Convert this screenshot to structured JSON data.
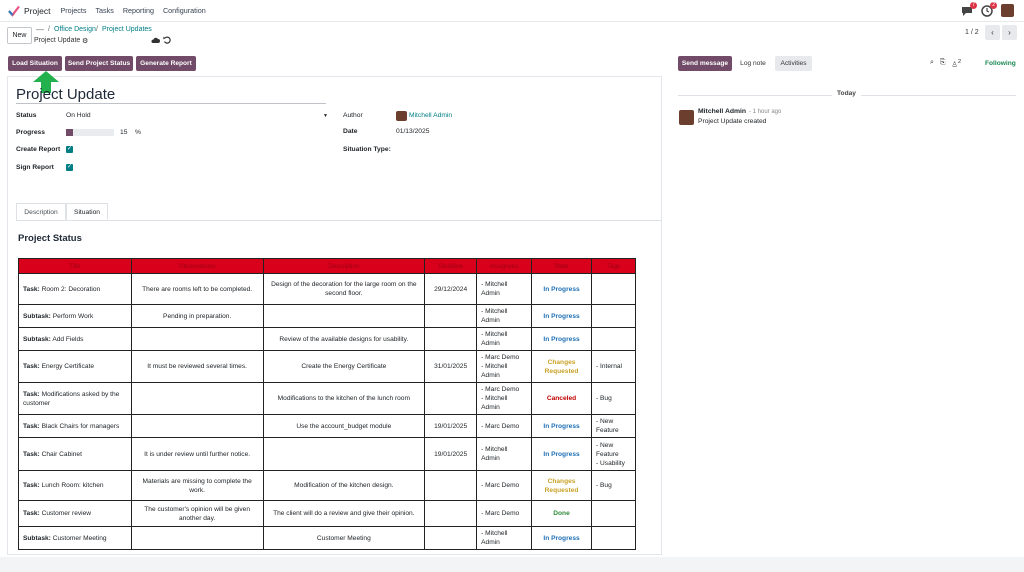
{
  "nav": {
    "app_name": "Project",
    "menu": [
      "Projects",
      "Tasks",
      "Reporting",
      "Configuration"
    ],
    "badges": {
      "chat": "7",
      "activity": "2"
    }
  },
  "control": {
    "new_label": "New",
    "breadcrumb": {
      "dash": "—",
      "sep": "/",
      "crumb1": "Office Design",
      "crumb2": "Project Updates",
      "current": "Project Update"
    },
    "pager": "1 / 2"
  },
  "actions": {
    "load": "Load Situation",
    "send_status": "Send Project Status",
    "generate": "Generate Report"
  },
  "form": {
    "title": "Project Update",
    "status_label": "Status",
    "status_value": "On Hold",
    "progress_label": "Progress",
    "progress_value": "15",
    "progress_unit": "%",
    "progress_fraction": 0.15,
    "create_report_label": "Create Report",
    "sign_report_label": "Sign Report",
    "author_label": "Author",
    "author_value": "Mitchell Admin",
    "date_label": "Date",
    "date_value": "01/13/2025",
    "situation_type_label": "Situation Type:"
  },
  "tabs": [
    "Description",
    "Situation"
  ],
  "section_title": "Project Status",
  "table": {
    "headers": [
      "Title",
      "Observations",
      "Description",
      "Deadline",
      "Assignees",
      "State",
      "Tags"
    ],
    "rows": [
      {
        "kind": "Task:",
        "title": " Room 2: Decoration",
        "obs": "There are rooms left to be completed.",
        "desc": "Design of the decoration for the large room on the second floor.",
        "deadline": "29/12/2024",
        "assignees": [
          "- Mitchell Admin"
        ],
        "state": "In Progress",
        "state_color": "#1f6fb5",
        "tags": []
      },
      {
        "kind": "Subtask:",
        "title": " Perform Work",
        "obs": "Pending in preparation.",
        "desc": "",
        "deadline": "",
        "assignees": [
          "- Mitchell Admin"
        ],
        "state": "In Progress",
        "state_color": "#1f6fb5",
        "tags": []
      },
      {
        "kind": "Subtask:",
        "title": " Add Fields",
        "obs": "",
        "desc": "Review of the available designs for usability.",
        "deadline": "",
        "assignees": [
          "- Mitchell Admin"
        ],
        "state": "In Progress",
        "state_color": "#1f6fb5",
        "tags": []
      },
      {
        "kind": "Task:",
        "title": " Energy Certificate",
        "obs": "It must be reviewed several times.",
        "desc": "Create the Energy Certificate",
        "deadline": "31/01/2025",
        "assignees": [
          "- Marc Demo",
          "- Mitchell Admin"
        ],
        "state": "Changes Requested",
        "state_color": "#c9a227",
        "tags": [
          "- Internal"
        ]
      },
      {
        "kind": "Task:",
        "title": " Modifications asked by the customer",
        "obs": "",
        "desc": "Modifications to the kitchen of the lunch room",
        "deadline": "",
        "assignees": [
          "- Marc Demo",
          "- Mitchell Admin"
        ],
        "state": "Canceled",
        "state_color": "#c00000",
        "tags": [
          "- Bug"
        ]
      },
      {
        "kind": "Task:",
        "title": " Black Chairs for managers",
        "obs": "",
        "desc": "Use the account_budget module",
        "deadline": "19/01/2025",
        "assignees": [
          "- Marc Demo"
        ],
        "state": "In Progress",
        "state_color": "#1f6fb5",
        "tags": [
          "- New Feature"
        ]
      },
      {
        "kind": "Task:",
        "title": " Chair Cabinet",
        "obs": "It is under review until further notice.",
        "desc": "",
        "deadline": "19/01/2025",
        "assignees": [
          "- Mitchell Admin"
        ],
        "state": "In Progress",
        "state_color": "#1f6fb5",
        "tags": [
          "- New Feature",
          "- Usability"
        ]
      },
      {
        "kind": "Task:",
        "title": " Lunch Room: kitchen",
        "obs": "Materials are missing to complete the work.",
        "desc": "Modification of the kitchen design.",
        "deadline": "",
        "assignees": [
          "- Marc Demo"
        ],
        "state": "Changes Requested",
        "state_color": "#c9a227",
        "tags": [
          "- Bug"
        ]
      },
      {
        "kind": "Task:",
        "title": " Customer review",
        "obs": "The customer's opinion will be given another day.",
        "desc": "The client will do a review and give their opinion.",
        "deadline": "",
        "assignees": [
          "- Marc Demo"
        ],
        "state": "Done",
        "state_color": "#2e8b3a",
        "tags": []
      },
      {
        "kind": "Subtask:",
        "title": " Customer Meeting",
        "obs": "",
        "desc": "Customer Meeting",
        "deadline": "",
        "assignees": [
          "- Mitchell Admin"
        ],
        "state": "In Progress",
        "state_color": "#1f6fb5",
        "tags": []
      }
    ]
  },
  "chatter": {
    "send_message": "Send message",
    "log_note": "Log note",
    "activities": "Activities",
    "followers_count": "2",
    "following": "Following",
    "today": "Today",
    "message": {
      "author": "Mitchell Admin",
      "time": "- 1 hour ago",
      "body": "Project Update created"
    }
  },
  "colors": {
    "brand": "#714b67",
    "link": "#017e84",
    "table_header": "#d9001b"
  }
}
